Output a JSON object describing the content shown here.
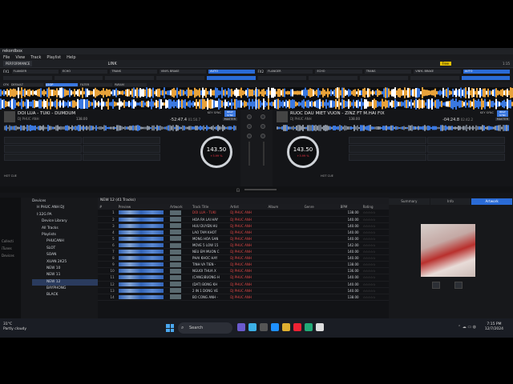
{
  "app": {
    "title": "rekordbox",
    "menu": [
      "File",
      "View",
      "Track",
      "Playlist",
      "Help"
    ],
    "mode": "PERFORMANCE",
    "link": "LINK",
    "free_badge": "Free",
    "clock_time": "1:15"
  },
  "fx": {
    "left_label": "FX1",
    "right_label": "FX2",
    "left_slots": [
      "FLANGER",
      "ECHO",
      "TRANS",
      "VINYL BRAKE",
      "AUTO"
    ],
    "right_slots": [
      "FLANGER",
      "ECHO",
      "TRANS",
      "VINYL BRAKE",
      "AUTO"
    ],
    "cfx_label": "CFX",
    "cfx_slots": [
      "DEFAULT",
      "LOOP",
      "FILTER",
      "PARAM"
    ]
  },
  "deck1": {
    "title": "DOI LUA - TUKI - DUMDUM",
    "artist": "DJ PHUC ANH",
    "bpm_small": "138.00",
    "key_sync": "KEY SYNC",
    "beat_sync": "BEAT SYNC",
    "master": "MASTER",
    "remaining": "-52:47.4",
    "elapsed": "01:50.7",
    "jog_bpm": "143.50",
    "jog_pitch": "+3.99 %",
    "hotcue": "HOT CUE"
  },
  "deck2": {
    "title": "RUOC DAU MIET VUON - ZINZ  FT M.HAI FIX",
    "artist": "DJ PHUC ANH",
    "bpm_small": "138.00",
    "key_sync": "KEY SYNC",
    "beat_sync": "BEAT SYNC",
    "master": "MASTER",
    "remaining": "-04:24.8",
    "elapsed": "02:42.2",
    "jog_bpm": "143.50",
    "jog_pitch": "+3.99 %",
    "hotcue": "HOT CUE"
  },
  "browser": {
    "playlist_header": "NEW 12 (41 Tracks)",
    "tree_side_labels": [
      "Collecti",
      "iTunes",
      "Devices"
    ],
    "tree": [
      {
        "label": "Devices",
        "selected": false
      },
      {
        "label": "H PHUC ANH DJ",
        "selected": false
      },
      {
        "label": "I:32G PA",
        "selected": false
      },
      {
        "label": "Device Library",
        "selected": false
      },
      {
        "label": "All Tracks",
        "selected": false
      },
      {
        "label": "Playlists",
        "selected": false
      },
      {
        "label": "PHUCANH",
        "selected": false
      },
      {
        "label": "SLOT",
        "selected": false
      },
      {
        "label": "SOAN",
        "selected": false
      },
      {
        "label": "XUAN 2K25",
        "selected": false
      },
      {
        "label": "NEW 10",
        "selected": false
      },
      {
        "label": "NEW 11",
        "selected": false
      },
      {
        "label": "NEW 12",
        "selected": true
      },
      {
        "label": "BAYPHONG",
        "selected": false
      },
      {
        "label": "BLACK",
        "selected": false
      }
    ],
    "columns": [
      "#",
      "Preview",
      "Artwork",
      "Track Title",
      "Artist",
      "Album",
      "Genre",
      "BPM",
      "Rating"
    ],
    "rows": [
      {
        "no": "1",
        "title": "DOI LUA - TUKI",
        "artist": "DJ PHUC ANH",
        "bpm": "138.00",
        "stars": "☆☆☆☆☆",
        "red": true
      },
      {
        "no": "2",
        "title": "HOA RA LAI HAY",
        "artist": "DJ PHUC ANH",
        "bpm": "140.00",
        "stars": "☆☆☆☆☆",
        "red": false
      },
      {
        "no": "3",
        "title": "HUU DUYEN HU",
        "artist": "DJ PHUC ANH",
        "bpm": "140.00",
        "stars": "☆☆☆☆☆",
        "red": false
      },
      {
        "no": "4",
        "title": "LAO TAM KHOT",
        "artist": "DJ PHUC ANH",
        "bpm": "140.00",
        "stars": "☆☆☆☆☆",
        "red": false
      },
      {
        "no": "5",
        "title": "MONG HOA SAN",
        "artist": "DJ PHUC ANH",
        "bpm": "140.00",
        "stars": "☆☆☆☆☆",
        "red": false
      },
      {
        "no": "6",
        "title": "MOVE 5 LOW 15",
        "artist": "DJ PHUC ANH",
        "bpm": "142.00",
        "stars": "☆☆☆☆☆",
        "red": false
      },
      {
        "no": "7",
        "title": "NEU EM MUON C",
        "artist": "DJ PHUC ANH",
        "bpm": "140.00",
        "stars": "☆☆☆☆☆",
        "red": false
      },
      {
        "no": "8",
        "title": "PHAI KHOC HAY",
        "artist": "DJ PHUC ANH",
        "bpm": "140.00",
        "stars": "☆☆☆☆☆",
        "red": false
      },
      {
        "no": "9",
        "title": "TINH VA TIEN -",
        "artist": "DJ PHUC ANH",
        "bpm": "138.00",
        "stars": "☆☆☆☆☆",
        "red": false
      },
      {
        "no": "10",
        "title": "NGUOI THUA X",
        "artist": "DJ PHUC ANH",
        "bpm": "136.00",
        "stars": "☆☆☆☆☆",
        "red": false
      },
      {
        "no": "11",
        "title": "(CANG)BUONG H",
        "artist": "DJ PHUC ANH",
        "bpm": "140.00",
        "stars": "☆☆☆☆☆",
        "red": false
      },
      {
        "no": "12",
        "title": "(DAT) BONG KH",
        "artist": "DJ PHUC ANH",
        "bpm": "140.00",
        "stars": "☆☆☆☆☆",
        "red": false
      },
      {
        "no": "13",
        "title": "2 IN 1 DONG VE",
        "artist": "DJ PHUC ANH",
        "bpm": "140.00",
        "stars": "☆☆☆☆☆",
        "red": false
      },
      {
        "no": "14",
        "title": "BO CONG ANH -",
        "artist": "DJ PHUC ANH",
        "bpm": "138.00",
        "stars": "☆☆☆☆☆",
        "red": false
      }
    ],
    "right_tabs": [
      "Summary",
      "Info",
      "Artwork"
    ]
  },
  "taskbar": {
    "weather_temp": "31°C",
    "weather_desc": "Partly cloudy",
    "search_placeholder": "Search",
    "time": "7:15 PM",
    "date": "12/7/2024"
  },
  "colors": {
    "accent_blue": "#2a6bd6",
    "waveform_orange": "#e8a23a",
    "waveform_blue": "#3a78e0",
    "taskbar": "#1a1d24"
  }
}
